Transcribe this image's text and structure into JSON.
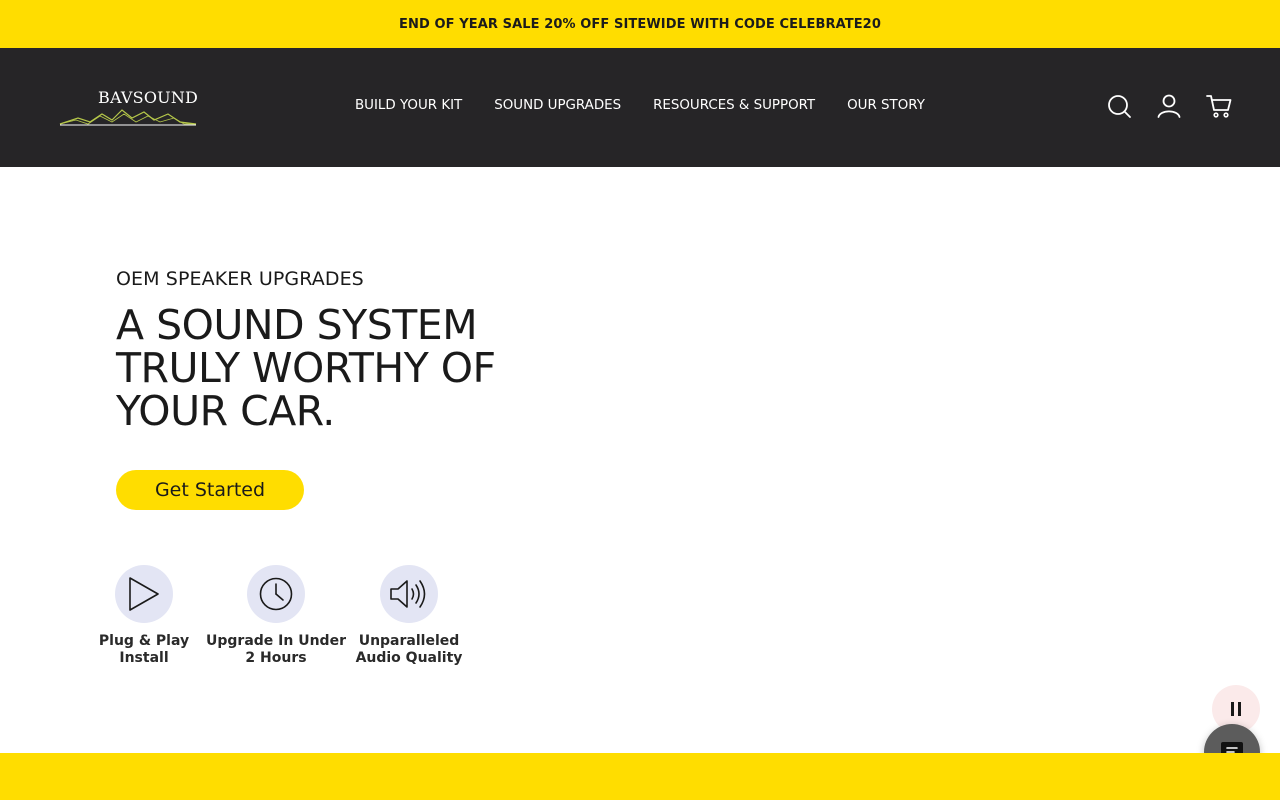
{
  "promo": {
    "text": "END OF YEAR SALE 20% OFF SITEWIDE WITH CODE CELEBRATE20"
  },
  "brand": {
    "logo_text": "BAVSOUND"
  },
  "nav": {
    "items": [
      {
        "label": "BUILD YOUR KIT"
      },
      {
        "label": "SOUND UPGRADES"
      },
      {
        "label": "RESOURCES & SUPPORT"
      },
      {
        "label": "OUR STORY"
      }
    ]
  },
  "header_icons": [
    "search-icon",
    "account-icon",
    "cart-icon"
  ],
  "hero": {
    "eyebrow": "OEM SPEAKER UPGRADES",
    "headline": "A SOUND SYSTEM TRULY WORTHY OF YOUR CAR.",
    "cta_label": "Get Started"
  },
  "features": [
    {
      "icon": "play-icon",
      "label": "Plug & Play Install"
    },
    {
      "icon": "clock-icon",
      "label": "Upgrade In Under 2 Hours"
    },
    {
      "icon": "speaker-icon",
      "label": "Unparalleled Audio Quality"
    }
  ],
  "colors": {
    "promo_bg": "#FFDD00",
    "header_bg": "#262527",
    "cta_bg": "#FFDD00",
    "feature_circle": "#E3E5F4",
    "logo_wave": "#B6C84A"
  }
}
